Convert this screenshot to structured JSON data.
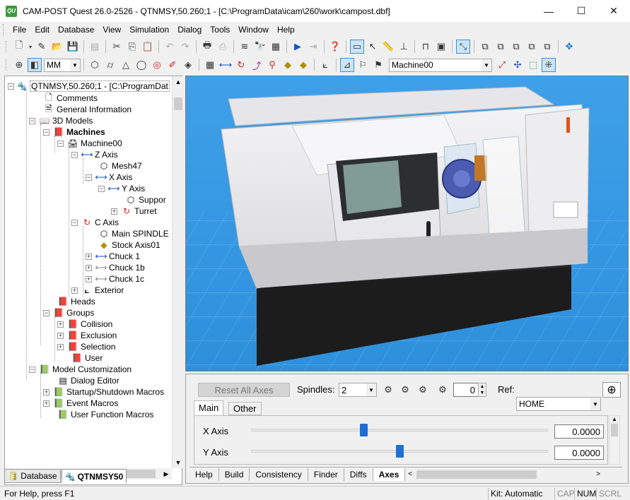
{
  "window": {
    "title": "CAM-POST Quest 26.0-2526 - QTNMSY,50.260;1 - [C:\\ProgramData\\icam\\260\\work\\campost.dbf]",
    "app_icon_text": "QU",
    "minimize": "—",
    "maximize": "☐",
    "close": "✕"
  },
  "menu": [
    "File",
    "Edit",
    "Database",
    "View",
    "Simulation",
    "Dialog",
    "Tools",
    "Window",
    "Help"
  ],
  "toolbar2": {
    "units": "MM",
    "machine_combo": "Machine00"
  },
  "tree": {
    "root": "QTNMSY,50.260;1 - [C:\\ProgramDat",
    "comments": "Comments",
    "general_info": "General Information",
    "models": "3D Models",
    "machines": "Machines",
    "machine00": "Machine00",
    "z_axis": "Z Axis",
    "mesh47": "Mesh47",
    "x_axis": "X Axis",
    "y_axis": "Y Axis",
    "support": "Suppor",
    "turret": "Turret",
    "c_axis": "C Axis",
    "main_spindle": "Main SPINDLE",
    "stock_axis": "Stock Axis01",
    "chuck1": "Chuck 1",
    "chuck1b": "Chuck 1b",
    "chuck1c": "Chuck 1c",
    "exterior": "Exterior",
    "heads": "Heads",
    "groups": "Groups",
    "collision": "Collision",
    "exclusion": "Exclusion",
    "selection": "Selection",
    "user": "User",
    "model_cust": "Model Customization",
    "dialog_editor": "Dialog Editor",
    "startup_macros": "Startup/Shutdown Macros",
    "event_macros": "Event Macros",
    "user_func_macros": "User Function Macros"
  },
  "left_tabs": [
    "Database",
    "QTNMSY50"
  ],
  "axes_panel": {
    "reset_label": "Reset All Axes",
    "spindles_label": "Spindles:",
    "spindles_value": "2",
    "spindle_count": "0",
    "ref_label": "Ref:",
    "ref_value": "HOME",
    "tabs": [
      "Main",
      "Other"
    ],
    "axes": [
      {
        "name": "X Axis",
        "value": "0.0000",
        "position": 0.38
      },
      {
        "name": "Y Axis",
        "value": "0.0000",
        "position": 0.5
      }
    ]
  },
  "bottom_tabs": [
    "Help",
    "Build",
    "Consistency",
    "Finder",
    "Diffs",
    "Axes"
  ],
  "status": {
    "help": "For Help, press F1",
    "kit": "Kit: Automatic",
    "cap": "CAP",
    "num": "NUM",
    "scrl": "SCRL"
  },
  "colors": {
    "viewport_sky": "#3799e4",
    "selection_blue": "#1f6fd1"
  }
}
